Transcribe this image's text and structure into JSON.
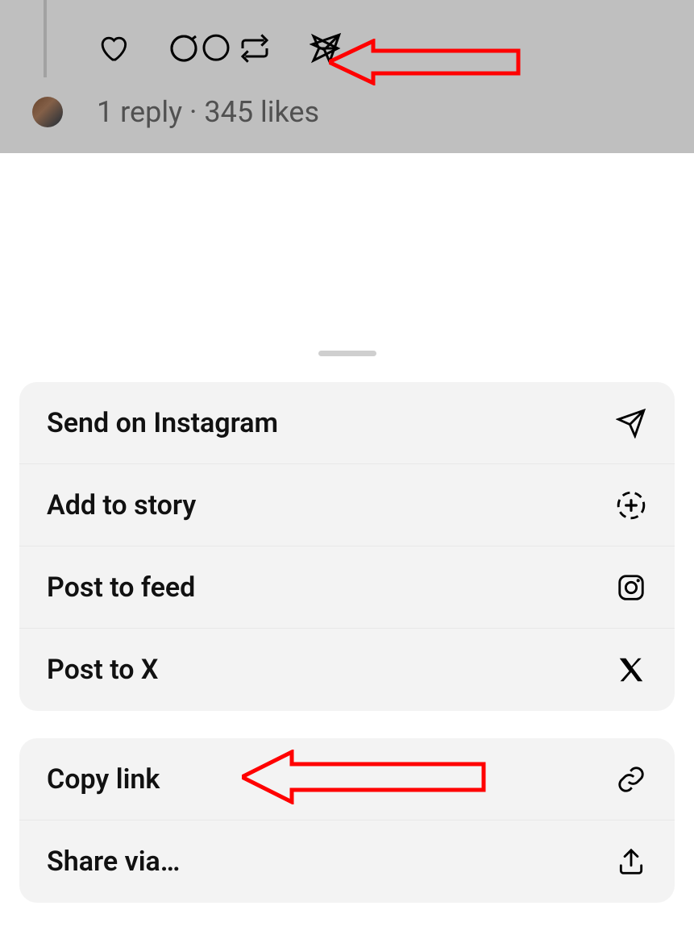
{
  "feed": {
    "reply_text": "1 reply",
    "separator": " · ",
    "likes_text": "345 likes"
  },
  "sheet": {
    "group1": [
      {
        "label": "Send on Instagram",
        "icon": "send-icon"
      },
      {
        "label": "Add to story",
        "icon": "add-story-icon"
      },
      {
        "label": "Post to feed",
        "icon": "instagram-icon"
      },
      {
        "label": "Post to X",
        "icon": "x-logo-icon"
      }
    ],
    "group2": [
      {
        "label": "Copy link",
        "icon": "link-icon"
      },
      {
        "label": "Share via…",
        "icon": "upload-icon"
      }
    ]
  },
  "annotations": {
    "arrow_color": "#ff0000"
  }
}
